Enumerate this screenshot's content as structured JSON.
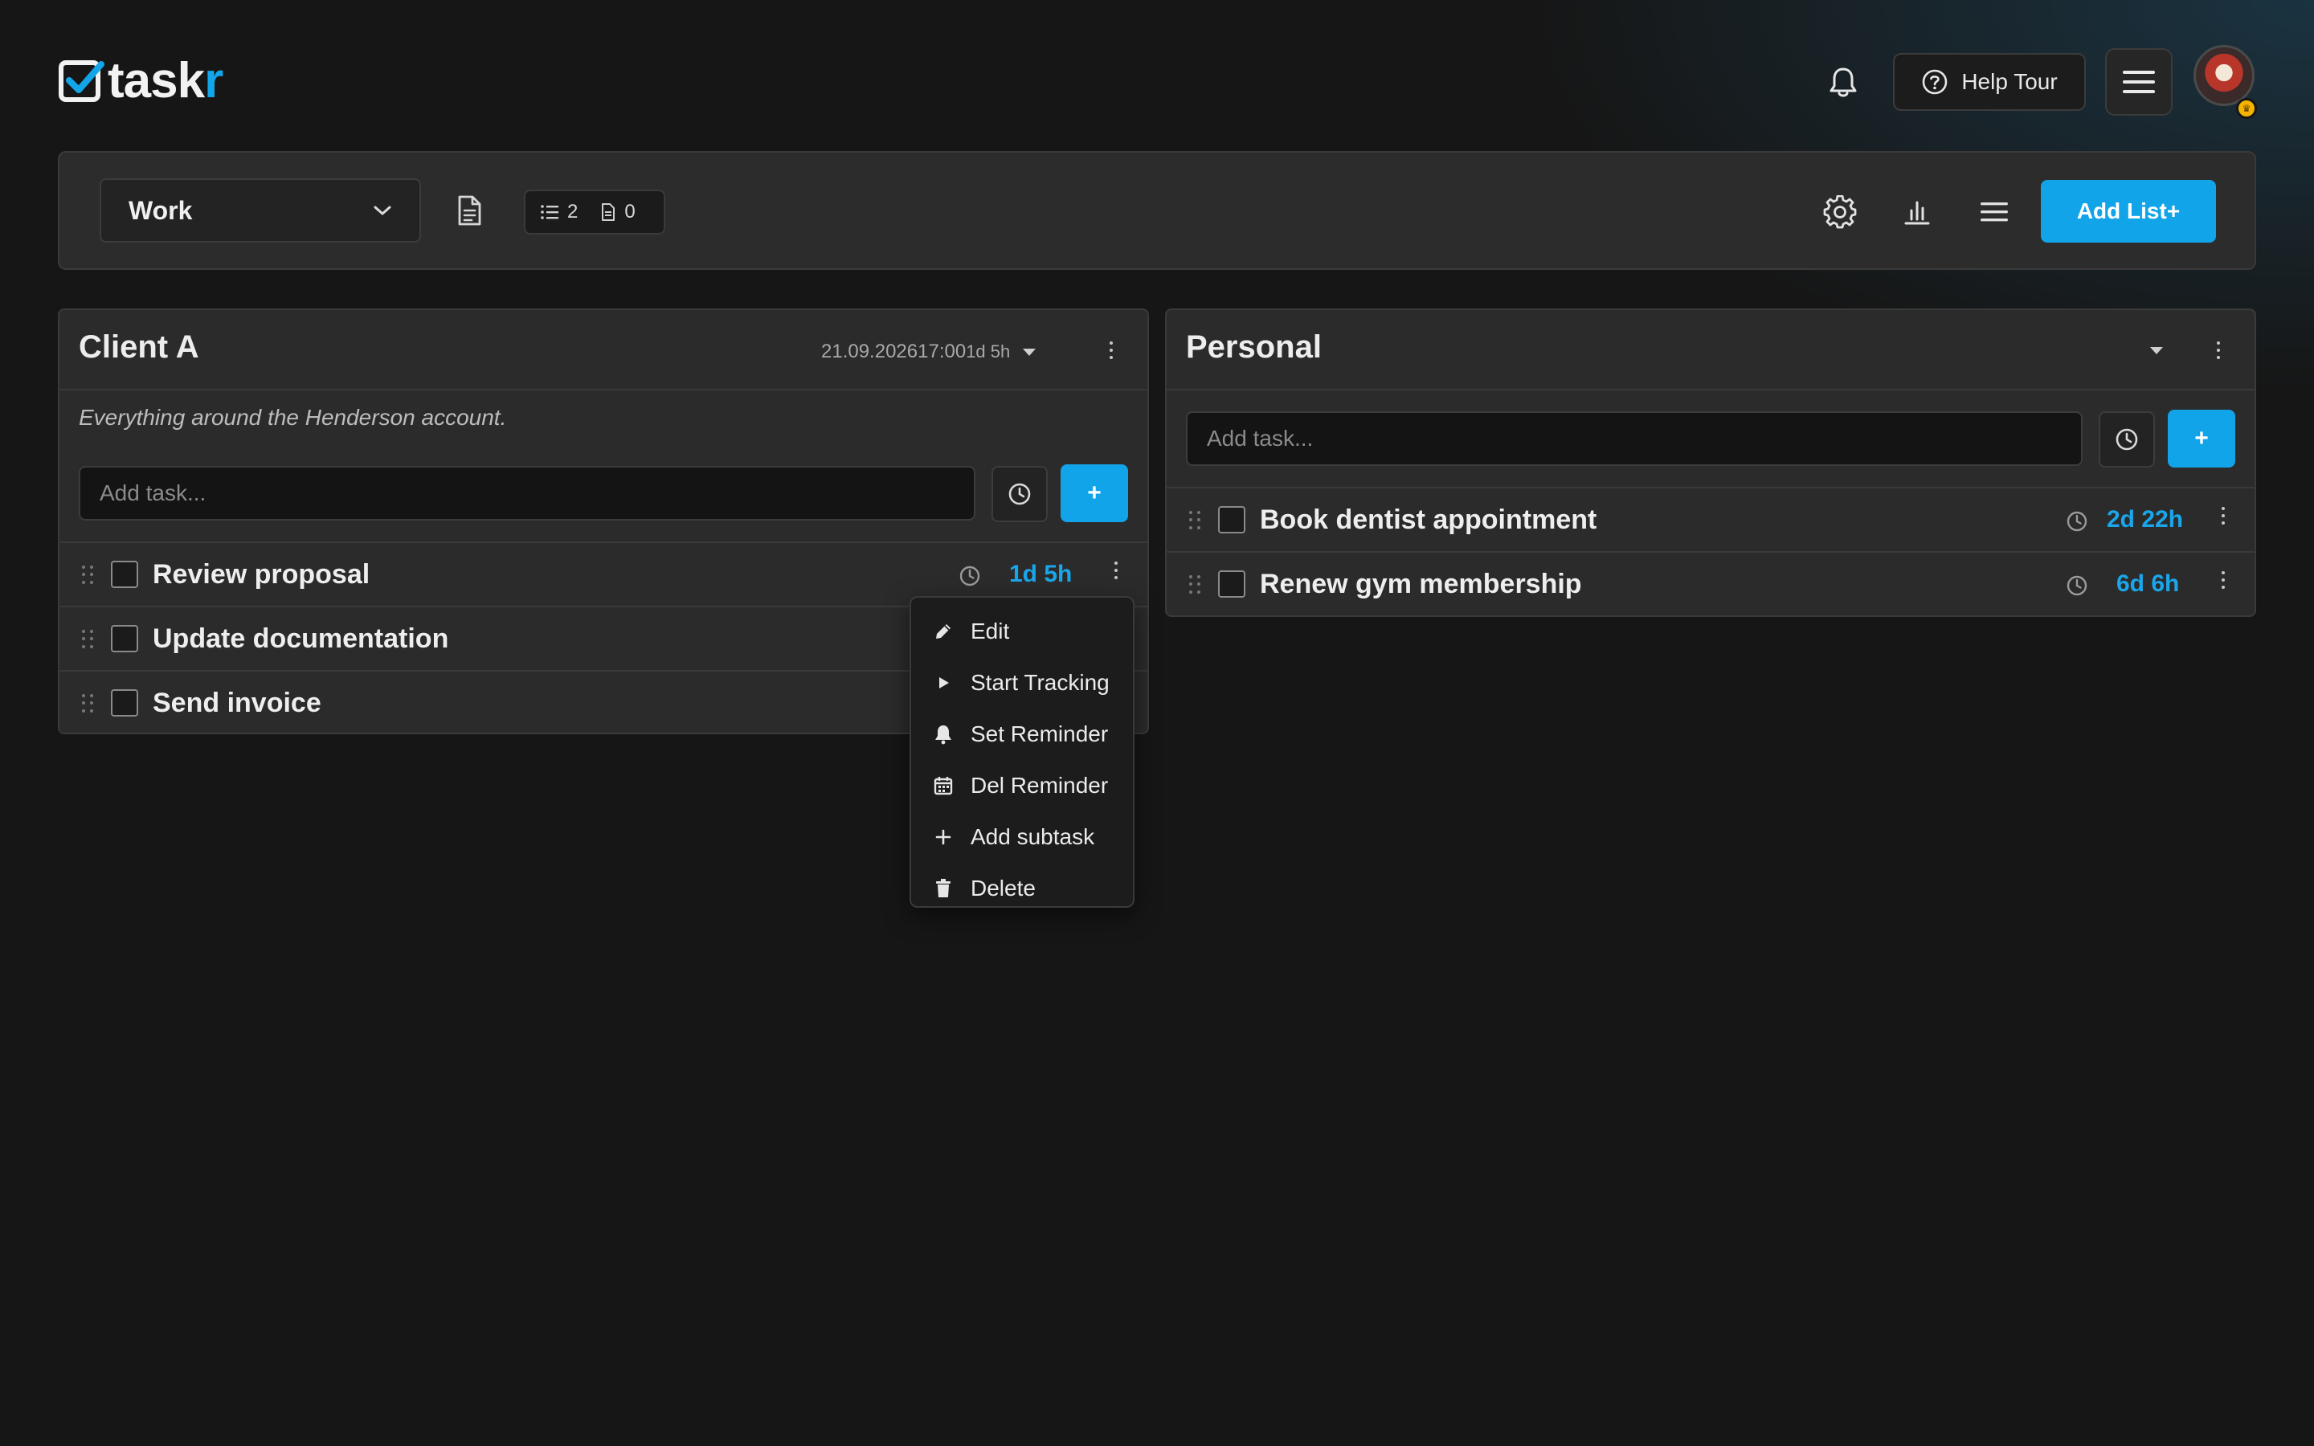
{
  "app": {
    "logo_main": "task",
    "logo_accent": "r",
    "help_tour_label": "Help Tour"
  },
  "toolbar": {
    "board_name": "Work",
    "list_count": "2",
    "doc_count": "0",
    "add_list_label": "Add List+"
  },
  "lists": [
    {
      "title": "Client A",
      "due_date": "21.09.2026",
      "due_time": "17:00",
      "due_remaining": "1d 5h",
      "description": "Everything around the Henderson account.",
      "input_placeholder": "Add task...",
      "add_label": "+",
      "tasks": [
        {
          "title": "Review proposal",
          "remaining": "1d 5h"
        },
        {
          "title": "Update documentation"
        },
        {
          "title": "Send invoice"
        }
      ]
    },
    {
      "title": "Personal",
      "input_placeholder": "Add task...",
      "add_label": "+",
      "tasks": [
        {
          "title": "Book dentist appointment",
          "remaining": "2d 22h"
        },
        {
          "title": "Renew gym membership",
          "remaining": "6d 6h"
        }
      ]
    }
  ],
  "context_menu": {
    "items": [
      {
        "label": "Edit",
        "icon": "pencil-icon"
      },
      {
        "label": "Start Tracking",
        "icon": "play-icon"
      },
      {
        "label": "Set Reminder",
        "icon": "bell-icon"
      },
      {
        "label": "Del Reminder",
        "icon": "calendar-icon"
      },
      {
        "label": "Add subtask",
        "icon": "plus-icon"
      },
      {
        "label": "Delete",
        "icon": "trash-icon"
      }
    ]
  },
  "colors": {
    "accent": "#12a4e8",
    "background": "#161616",
    "panel": "#2b2b2b"
  }
}
